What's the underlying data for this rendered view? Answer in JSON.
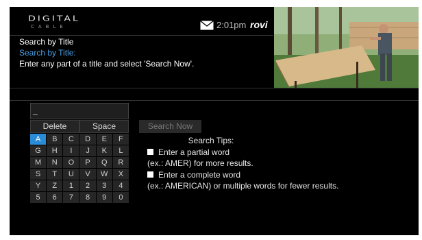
{
  "header": {
    "brand_main": "DIGITAL",
    "brand_sub": "CABLE",
    "time": "2:01pm",
    "partner_logo": "rovi",
    "mail_icon": "mail-icon"
  },
  "page": {
    "title": "Search by Title",
    "subtitle": "Search by Title:",
    "instruction": "Enter any part of a title and select 'Search Now'."
  },
  "keyboard": {
    "input_value": "_",
    "delete_label": "Delete",
    "space_label": "Space",
    "selected_key": "A",
    "keys": [
      "A",
      "B",
      "C",
      "D",
      "E",
      "F",
      "G",
      "H",
      "I",
      "J",
      "K",
      "L",
      "M",
      "N",
      "O",
      "P",
      "Q",
      "R",
      "S",
      "T",
      "U",
      "V",
      "W",
      "X",
      "Y",
      "Z",
      "1",
      "2",
      "3",
      "4",
      "5",
      "6",
      "7",
      "8",
      "9",
      "0"
    ]
  },
  "search_now_label": "Search Now",
  "tips": {
    "heading": "Search Tips:",
    "tip1": "Enter a partial word",
    "tip1_example": "(ex.: AMER) for more results.",
    "tip2": "Enter a complete word",
    "tip2_example": "(ex.: AMERICAN) or multiple words for fewer results."
  },
  "colors": {
    "accent": "#2a8bd6",
    "subtitle": "#4aa0e6",
    "background": "#000000"
  }
}
